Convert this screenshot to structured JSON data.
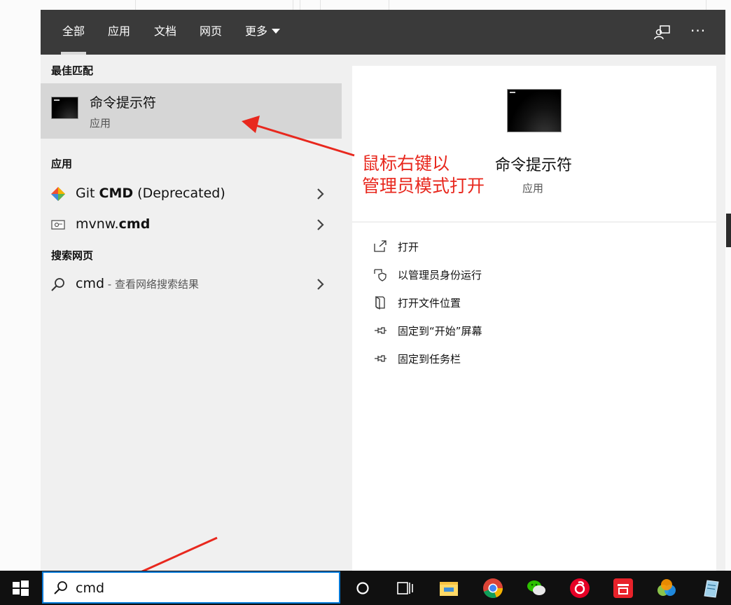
{
  "tabs": [
    {
      "label": "全部"
    },
    {
      "label": "应用"
    },
    {
      "label": "文档"
    },
    {
      "label": "网页"
    },
    {
      "label": "更多"
    }
  ],
  "top_icons": {
    "feedback": "feedback-icon",
    "more": "···"
  },
  "best_match": {
    "section": "最佳匹配",
    "title": "命令提示符",
    "subtitle": "应用"
  },
  "apps_section": "应用",
  "apps": [
    {
      "prefix": "Git ",
      "bold": "CMD",
      "suffix": " (Deprecated)"
    },
    {
      "prefix": "mvnw.",
      "bold": "cmd",
      "suffix": ""
    }
  ],
  "web_section": "搜索网页",
  "web_result": {
    "query": "cmd",
    "hint": " - 查看网络搜索结果"
  },
  "preview": {
    "title": "命令提示符",
    "subtitle": "应用"
  },
  "actions": [
    {
      "label": "打开",
      "icon": "open-icon"
    },
    {
      "label": "以管理员身份运行",
      "icon": "shield-icon"
    },
    {
      "label": "打开文件位置",
      "icon": "file-location-icon"
    },
    {
      "label": "固定到“开始”屏幕",
      "icon": "pin-icon"
    },
    {
      "label": "固定到任务栏",
      "icon": "pin-icon"
    }
  ],
  "annotation": {
    "line1": "鼠标右键以",
    "line2": "管理员模式打开",
    "color": "#e8281e"
  },
  "search": {
    "value": "cmd"
  },
  "colors": {
    "topbar": "#3a3a3a",
    "panel": "#f0f0f0",
    "selected": "#d6d6d6",
    "accent": "#0078d7"
  }
}
